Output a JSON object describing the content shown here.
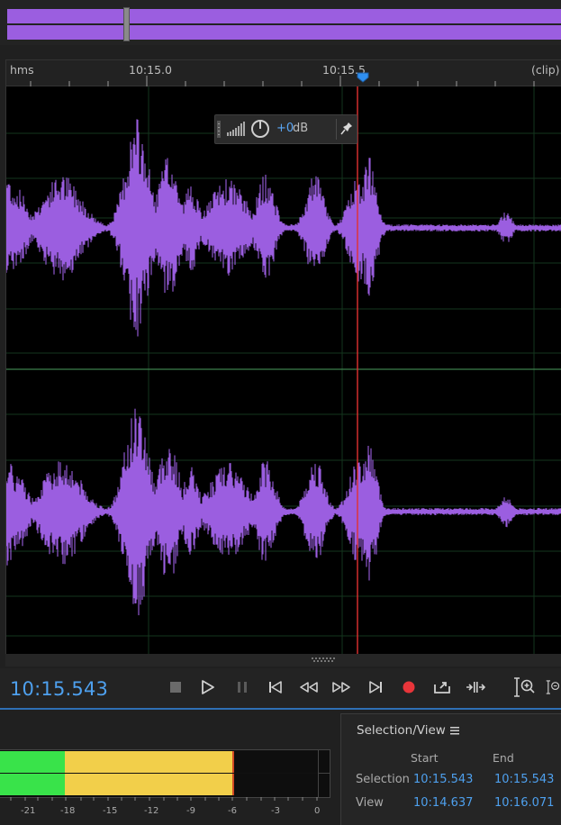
{
  "overview": {
    "waveform_color": "#9b5ee0"
  },
  "ruler": {
    "unit": "hms",
    "label_1": "10:15.0",
    "label_2": "10:15.5",
    "clip": "(clip)"
  },
  "waveform": {
    "color": "#9b5ee0",
    "playhead_color": "#e03030"
  },
  "hud": {
    "db_value": "+0",
    "db_unit": "dB"
  },
  "transport": {
    "time": "10:15.543",
    "buttons": [
      "stop",
      "play",
      "pause",
      "go-to-start",
      "rewind",
      "fast-forward",
      "go-to-end",
      "record",
      "loop-playback",
      "skip-selection",
      "zoom-in-amplitude",
      "zoom-out-amplitude"
    ]
  },
  "meters": {
    "scale": [
      "-21",
      "-18",
      "-15",
      "-12",
      "-9",
      "-6",
      "-3",
      "0"
    ],
    "green_color": "#39e34a",
    "yellow_color": "#f2cf4a"
  },
  "selection_view": {
    "title": "Selection/View",
    "col_start": "Start",
    "col_end": "End",
    "rows": [
      {
        "label": "Selection",
        "start": "10:15.543",
        "end": "10:15.543"
      },
      {
        "label": "View",
        "start": "10:14.637",
        "end": "10:16.071"
      }
    ]
  }
}
